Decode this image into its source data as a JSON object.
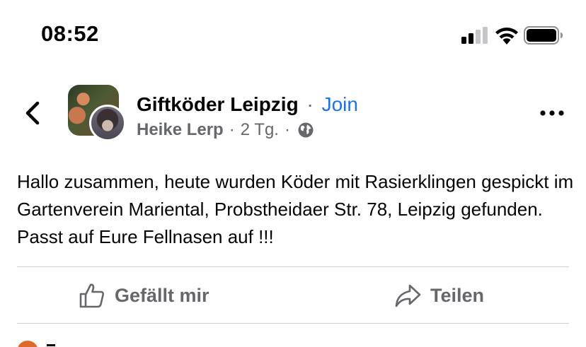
{
  "status_bar": {
    "time": "08:52",
    "icons": [
      "cellular-signal-icon",
      "wifi-icon",
      "battery-icon"
    ]
  },
  "header": {
    "group_name": "Giftköder Leipzig",
    "separator": "·",
    "join_label": "Join",
    "author": "Heike Lerp",
    "time_ago": "2 Tg.",
    "privacy_icon": "globe-icon",
    "back_icon": "chevron-left-icon",
    "more_icon": "more-options-icon"
  },
  "post": {
    "text": "Hallo zusammen, heute wurden Köder mit Rasierklingen gespickt im Gartenverein Mariental, Probstheidaer Str. 78, Leipzig gefunden. Passt auf Eure Fellnasen auf !!!"
  },
  "actions": {
    "like_label": "Gefällt mir",
    "share_label": "Teilen"
  },
  "colors": {
    "join": "#1b74e4",
    "secondary_text": "#65676b",
    "divider": "#ced0d4"
  }
}
